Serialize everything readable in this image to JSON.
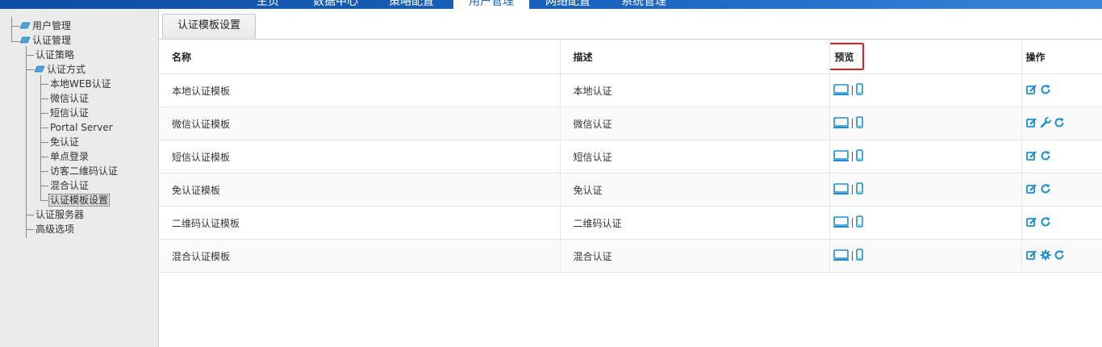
{
  "top_nav": {
    "items": [
      {
        "label": "主页"
      },
      {
        "label": "数据中心"
      },
      {
        "label": "策略配置"
      },
      {
        "label": "用户管理",
        "active": true
      },
      {
        "label": "网络配置"
      },
      {
        "label": "系统管理"
      }
    ]
  },
  "sidebar": {
    "user_mgmt": "用户管理",
    "auth_mgmt": "认证管理",
    "auth_policy": "认证策略",
    "auth_method": "认证方式",
    "local_web": "本地WEB认证",
    "wechat": "微信认证",
    "sms": "短信认证",
    "portal": "Portal Server",
    "no_auth": "免认证",
    "sso": "单点登录",
    "guest_qr": "访客二维码认证",
    "mixed": "混合认证",
    "template_settings": "认证模板设置",
    "auth_server": "认证服务器",
    "advanced": "高级选项"
  },
  "tab": {
    "label": "认证模板设置"
  },
  "table": {
    "headers": {
      "name": "名称",
      "desc": "描述",
      "preview": "预览",
      "ops": "操作"
    },
    "rows": [
      {
        "name": "本地认证模板",
        "desc": "本地认证",
        "ops": [
          "edit-icon",
          "refresh-icon"
        ]
      },
      {
        "name": "微信认证模板",
        "desc": "微信认证",
        "ops": [
          "edit-icon",
          "wrench-icon",
          "refresh-icon"
        ]
      },
      {
        "name": "短信认证模板",
        "desc": "短信认证",
        "ops": [
          "edit-icon",
          "refresh-icon"
        ]
      },
      {
        "name": "免认证模板",
        "desc": "免认证",
        "ops": [
          "edit-icon",
          "refresh-icon"
        ]
      },
      {
        "name": "二维码认证模板",
        "desc": "二维码认证",
        "ops": [
          "edit-icon",
          "refresh-icon"
        ]
      },
      {
        "name": "混合认证模板",
        "desc": "混合认证",
        "ops": [
          "edit-icon",
          "gear-icon",
          "refresh-icon"
        ]
      }
    ]
  },
  "colors": {
    "accent": "#1a8fd6",
    "highlight": "#e02020",
    "nav": "#1a63c0"
  }
}
